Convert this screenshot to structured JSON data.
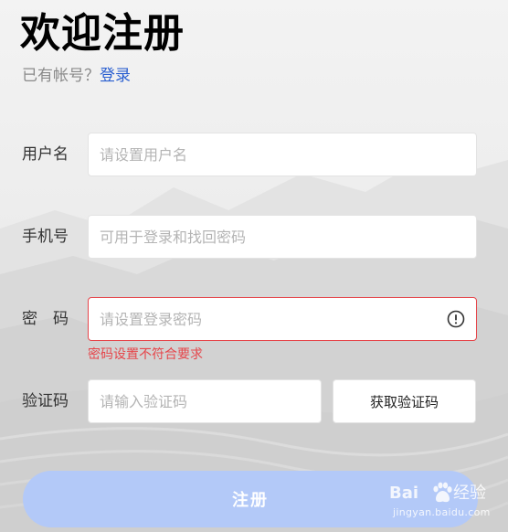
{
  "header": {
    "title": "欢迎注册",
    "have_account_text": "已有帐号？",
    "login_link": "登录"
  },
  "form": {
    "username": {
      "label": "用户名",
      "placeholder": "请设置用户名",
      "value": ""
    },
    "phone": {
      "label": "手机号",
      "placeholder": "可用于登录和找回密码",
      "value": ""
    },
    "password": {
      "label": "密　码",
      "placeholder": "请设置登录密码",
      "value": "",
      "error_message": "密码设置不符合要求",
      "error_icon": "exclamation-circle-icon"
    },
    "verification_code": {
      "label": "验证码",
      "placeholder": "请输入验证码",
      "value": "",
      "get_code_button": "获取验证码"
    }
  },
  "submit_button": "注册",
  "watermark": {
    "brand_prefix": "Bai",
    "brand_suffix": "经验",
    "url": "jingyan.baidu.com"
  },
  "colors": {
    "link": "#2a5fd0",
    "error": "#e6454a",
    "submit_button_bg": "#b3c9f8",
    "label_text": "#333333",
    "placeholder_text": "#b4b4b4"
  }
}
